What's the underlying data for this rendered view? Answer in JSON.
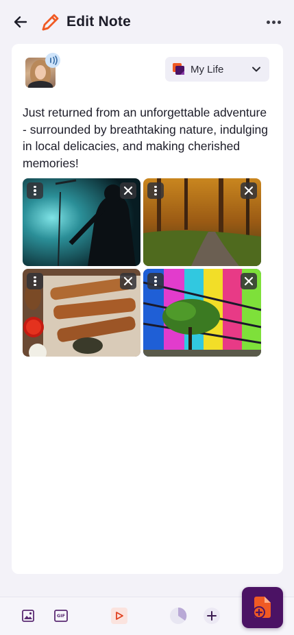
{
  "header": {
    "title": "Edit Note",
    "icons": {
      "back": "arrow-left-icon",
      "edit": "pencil-icon",
      "more": "more-horizontal-icon"
    }
  },
  "note": {
    "folder": {
      "label": "My Life",
      "icon": "folder-notes-icon"
    },
    "body": "Just returned from an unforgettable adventure - surrounded by breathtaking nature, indulging in local delicacies, and making cherished memories!",
    "attachments": [
      {
        "scene": "concert-guitarist"
      },
      {
        "scene": "autumn-forest-path"
      },
      {
        "scene": "grilled-food-platter"
      },
      {
        "scene": "colorful-glass-building"
      }
    ]
  },
  "toolbar": {
    "gif_label": "GIF",
    "tools": [
      "image-icon",
      "gif-icon",
      "play-icon",
      "pie-chart-icon",
      "plus-icon"
    ],
    "fab_icon": "add-note-icon"
  },
  "colors": {
    "accent_orange": "#f05a24",
    "brand_purple": "#4b1264",
    "background": "#f3f2f8",
    "card": "#ffffff"
  }
}
